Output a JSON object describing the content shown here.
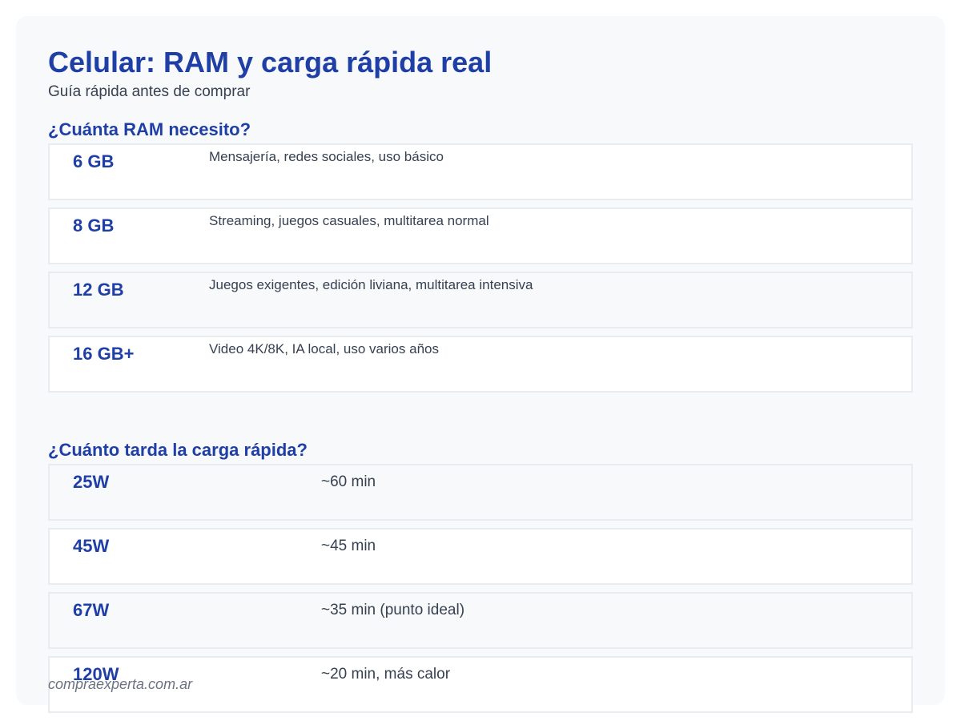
{
  "header": {
    "title": "Celular: RAM y carga rápida real",
    "subtitle": "Guía rápida antes de comprar"
  },
  "ram_section": {
    "title": "¿Cuánta RAM necesito?",
    "rows": [
      {
        "key": "6 GB",
        "desc": "Mensajería, redes sociales, uso básico"
      },
      {
        "key": "8 GB",
        "desc": "Streaming, juegos casuales, multitarea normal"
      },
      {
        "key": "12 GB",
        "desc": "Juegos exigentes, edición liviana, multitarea intensiva"
      },
      {
        "key": "16 GB+",
        "desc": "Video 4K/8K, IA local, uso varios años"
      }
    ]
  },
  "charge_section": {
    "title": "¿Cuánto tarda la carga rápida?",
    "rows": [
      {
        "key": "25W",
        "desc": "~60 min"
      },
      {
        "key": "45W",
        "desc": "~45 min"
      },
      {
        "key": "67W",
        "desc": "~35 min (punto ideal)"
      },
      {
        "key": "120W",
        "desc": "~20 min, más calor"
      }
    ]
  },
  "footer": {
    "source": "compraexperta.com.ar"
  },
  "colors": {
    "accent": "#1f3fa6",
    "text": "#374151",
    "card_background": "#f7f9fb",
    "row_border": "#e8ecf1",
    "footer_text": "#6b7280"
  }
}
